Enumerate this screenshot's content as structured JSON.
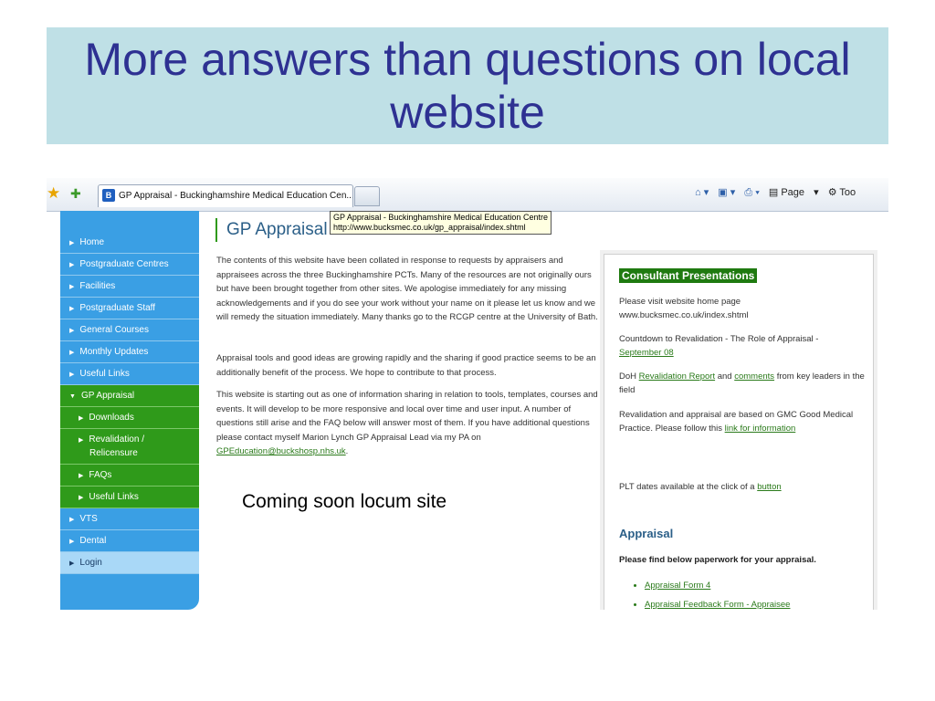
{
  "slide": {
    "title": "More answers than questions on local website",
    "annotation": "Coming soon locum site"
  },
  "browser": {
    "tab_title": "GP Appraisal - Buckinghamshire Medical Education Cen...",
    "tab_favicon": "B",
    "tooltip_line1": "GP Appraisal - Buckinghamshire Medical Education Centre",
    "tooltip_line2": "http://www.bucksmec.co.uk/gp_appraisal/index.shtml",
    "toolbar": {
      "page_label": "Page",
      "tools_label": "Too"
    }
  },
  "sidebar": {
    "items": [
      {
        "label": "Home"
      },
      {
        "label": "Postgraduate Centres"
      },
      {
        "label": "Facilities"
      },
      {
        "label": "Postgraduate Staff"
      },
      {
        "label": "General Courses"
      },
      {
        "label": "Monthly Updates"
      },
      {
        "label": "Useful Links"
      },
      {
        "label": "GP Appraisal"
      },
      {
        "label": "Downloads"
      },
      {
        "label": "Revalidation /"
      },
      {
        "label": "Relicensure"
      },
      {
        "label": "FAQs"
      },
      {
        "label": "Useful Links"
      },
      {
        "label": "VTS"
      },
      {
        "label": "Dental"
      },
      {
        "label": "Login"
      }
    ]
  },
  "main": {
    "heading": "GP Appraisal",
    "para1": "The contents of this website have been collated in response to requests by appraisers and appraisees across the three Buckinghamshire PCTs. Many of the resources are not originally ours but have been brought together from other sites. We apologise immediately for any missing acknowledgements and if you do see your work without your name on it please let us know and we will remedy the situation immediately. Many thanks go to the RCGP centre at the University of Bath.",
    "para2": "Appraisal tools and good ideas are growing rapidly and the sharing if good practice seems to be an additionally benefit of the process. We hope to contribute to that process.",
    "para3": "This website is starting out as one of information sharing in relation to tools, templates, courses and events. It will develop to be more responsive and local over time and user input. A number of questions still arise and the FAQ below will answer most of them. If you have additional questions please contact myself Marion Lynch GP Appraisal Lead via my PA on",
    "email": "GPEducation@buckshosp.nhs.uk",
    "period": "."
  },
  "panel": {
    "heading": "Consultant Presentations",
    "visit": "Please visit website home page",
    "url": "www.bucksmec.co.uk/index.shtml",
    "countdown": "Countdown to Revalidation  - The Role of Appraisal -",
    "countdown_link": "September 08",
    "doh_pre": "DoH",
    "doh_link1": "Revalidation Report",
    "doh_and": "and",
    "doh_link2": "comments",
    "doh_post": "from key leaders in the field",
    "gmc": "Revalidation and appraisal are based on GMC Good Medical Practice.  Please follow this",
    "gmc_link": "link for information",
    "plt": "PLT dates available at the click of a",
    "plt_link": "button",
    "appraisal_heading": "Appraisal",
    "appraisal_intro": "Please find below paperwork for your appraisal.",
    "forms": [
      "Appraisal Form 4",
      "Appraisal Feedback Form - Appraisee"
    ]
  }
}
